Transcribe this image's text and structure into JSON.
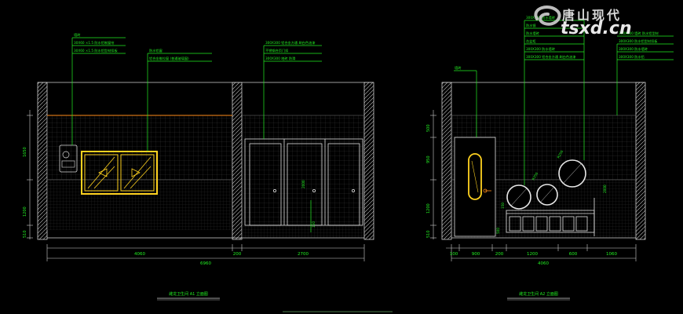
{
  "watermark": {
    "cn": "唐山现代",
    "en": "tsxd.cn"
  },
  "left_view": {
    "title": "雌龙卫生间  A1  立面图",
    "callouts": [
      "墙砖",
      "30X60 ×1.5 防水铝制窗帘",
      "30X60 ×1.5 防水铝型材扣板",
      "防水铝窗",
      "铝合金推拉窗 (普通玻璃窗)",
      "300X300 铝合金方通 刷白色油漆",
      "不锈钢合页门扣",
      "300X300 地砖 防滑"
    ],
    "dims_vertical": [
      "510",
      "1200",
      "1650"
    ],
    "dims_bottom": [
      "4060",
      "200",
      "2700"
    ],
    "dim_total": "6960",
    "door_dims": [
      "2000",
      "150"
    ]
  },
  "right_view": {
    "title": "雌龙卫生间  A2  立面图",
    "callouts": [
      "墙砖",
      "300X300 防水墙砖",
      "防水镜",
      "防水墙砖",
      "台盆柜",
      "300X300 防水墙砖",
      "300X300 铝合金方通 刷白色油漆",
      "300X300 墙砖 防水铝型材",
      "300X300 防水铝型材扣板",
      "300X300 防水墙砖",
      "300X300 防水铝"
    ],
    "dims_vertical": [
      "510",
      "1200",
      "950",
      "500"
    ],
    "dims_bottom": [
      "100",
      "900",
      "200",
      "1200",
      "600",
      "1060"
    ],
    "dim_total": "4060",
    "fixture_dims": [
      "150",
      "500",
      "R350",
      "R250",
      "2000"
    ]
  }
}
